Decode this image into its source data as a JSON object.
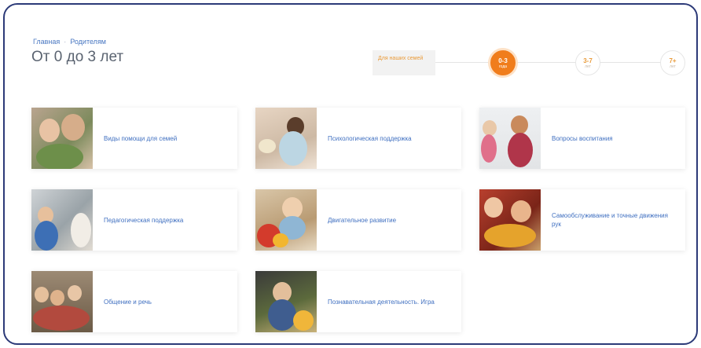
{
  "breadcrumb": {
    "home": "Главная",
    "separator": "·",
    "current": "Родителям"
  },
  "page_title": "От 0 до 3 лет",
  "stepper": {
    "family_label": "Для наших семей",
    "steps": [
      {
        "num": "0-3",
        "unit": "года",
        "active": true
      },
      {
        "num": "3-7",
        "unit": "лет",
        "active": false
      },
      {
        "num": "7+",
        "unit": "лет",
        "active": false
      }
    ]
  },
  "cards": [
    {
      "label": "Виды помощи для семей"
    },
    {
      "label": "Психологическая поддержка"
    },
    {
      "label": "Вопросы воспитания"
    },
    {
      "label": "Педагогическая поддержка"
    },
    {
      "label": "Двигательное развитие"
    },
    {
      "label": "Самообслуживание и точные движения рук"
    },
    {
      "label": "Общение и речь"
    },
    {
      "label": "Познавательная деятельность. Игра"
    }
  ],
  "colors": {
    "accent": "#f07d1c",
    "link": "#3f6fc0",
    "frame": "#2c3a78"
  }
}
